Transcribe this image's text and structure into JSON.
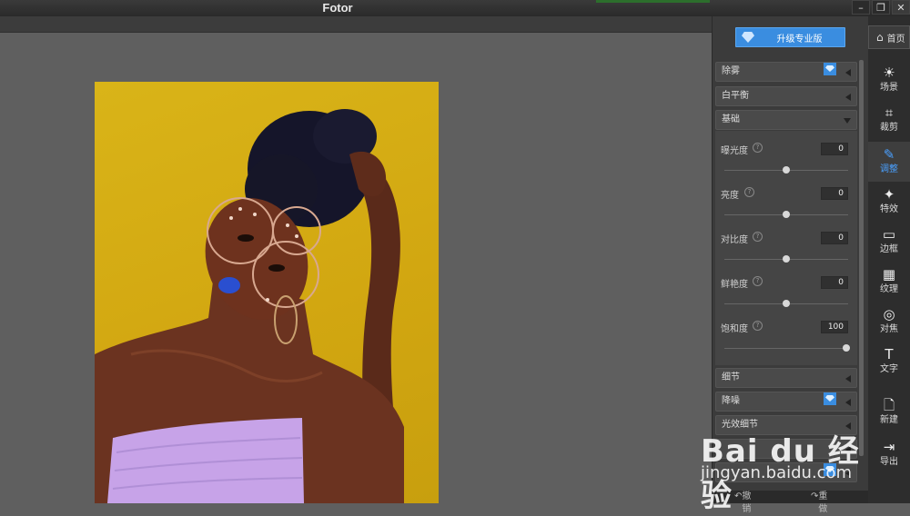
{
  "window": {
    "title": "Fotor",
    "controls": [
      "–",
      "❐",
      "✕"
    ]
  },
  "panel": {
    "upgrade_label": "升级专业版",
    "sections": {
      "dehaze": "除雾",
      "white_balance": "白平衡",
      "basic": "基础",
      "detail": "细节",
      "denoise": "降噪",
      "light_detail": "光效细节"
    },
    "adjustments": [
      {
        "label": "曝光度",
        "value": "0",
        "level": 0.5
      },
      {
        "label": "亮度",
        "value": "0",
        "level": 0.5
      },
      {
        "label": "对比度",
        "value": "0",
        "level": 0.5
      },
      {
        "label": "鲜艳度",
        "value": "0",
        "level": 0.5
      },
      {
        "label": "饱和度",
        "value": "100",
        "level": 1.0
      }
    ],
    "undo_label": "撤销",
    "redo_label": "重做"
  },
  "nav": {
    "home_label": "首页",
    "items": [
      {
        "label": "场景",
        "icon": "sun-icon"
      },
      {
        "label": "裁剪",
        "icon": "crop-icon"
      },
      {
        "label": "调整",
        "icon": "pencil-icon"
      },
      {
        "label": "特效",
        "icon": "sparkle-icon"
      },
      {
        "label": "边框",
        "icon": "frame-icon"
      },
      {
        "label": "纹理",
        "icon": "checker-icon"
      },
      {
        "label": "对焦",
        "icon": "focus-icon"
      },
      {
        "label": "文字",
        "icon": "text-icon"
      },
      {
        "label": "新建",
        "icon": "new-file-icon"
      },
      {
        "label": "导出",
        "icon": "export-icon"
      }
    ]
  },
  "watermark": {
    "brand": "Bai du 经验",
    "url": "jingyan.baidu.com"
  },
  "colors": {
    "accent": "#3a8de0",
    "active_nav": "#4aa0ff",
    "photo_background": "#d4aa12"
  }
}
